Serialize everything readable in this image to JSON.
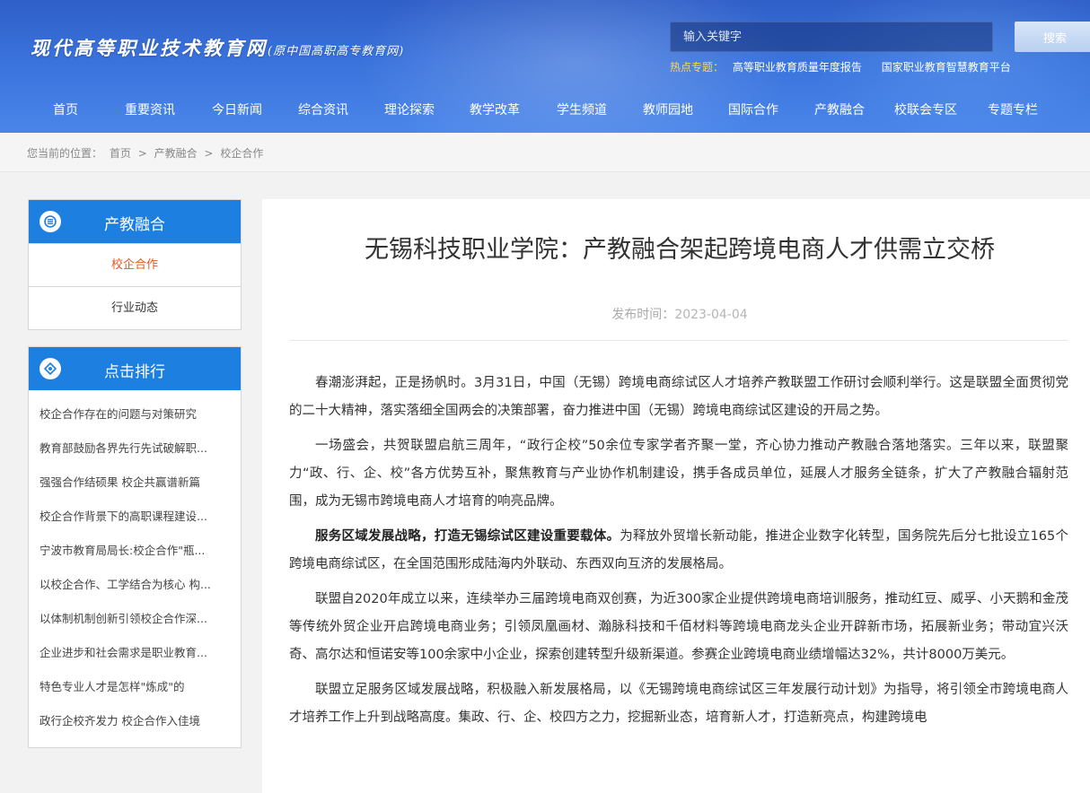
{
  "header": {
    "logo_main": "现代高等职业技术教育网",
    "logo_sub": "(原中国高职高专教育网)",
    "search_placeholder": "输入关键字",
    "search_button": "搜索",
    "hot_label": "热点专题：",
    "hot_links": [
      "高等职业教育质量年度报告",
      "国家职业教育智慧教育平台"
    ]
  },
  "nav": {
    "items": [
      "首页",
      "重要资讯",
      "今日新闻",
      "综合资讯",
      "理论探索",
      "教学改革",
      "学生频道",
      "教师园地",
      "国际合作",
      "产教融合",
      "校联会专区",
      "专题专栏"
    ]
  },
  "breadcrumb": {
    "label": "您当前的位置：",
    "items": [
      "首页",
      ">",
      "产教融合",
      ">",
      "校企合作"
    ]
  },
  "sidebar": {
    "category_title": "产教融合",
    "category_items": [
      "校企合作",
      "行业动态"
    ],
    "rank_title": "点击排行",
    "rank_items": [
      "校企合作存在的问题与对策研究",
      "教育部鼓励各界先行先试破解职...",
      "强强合作结硕果 校企共赢谱新篇",
      "校企合作背景下的高职课程建设...",
      "宁波市教育局局长:校企合作\"瓶...",
      "以校企合作、工学结合为核心 构...",
      "以体制机制创新引领校企合作深...",
      "企业进步和社会需求是职业教育...",
      "特色专业人才是怎样\"炼成\"的",
      "政行企校齐发力 校企合作入佳境"
    ]
  },
  "article": {
    "title": "无锡科技职业学院：产教融合架起跨境电商人才供需立交桥",
    "date_label": "发布时间：",
    "date": "2023-04-04",
    "p1": "春潮澎湃起，正是扬帆时。3月31日，中国（无锡）跨境电商综试区人才培养产教联盟工作研讨会顺利举行。这是联盟全面贯彻党的二十大精神，落实落细全国两会的决策部署，奋力推进中国（无锡）跨境电商综试区建设的开局之势。",
    "p2": "一场盛会，共贺联盟启航三周年，“政行企校”50余位专家学者齐聚一堂，齐心协力推动产教融合落地落实。三年以来，联盟聚力“政、行、企、校”各方优势互补，聚焦教育与产业协作机制建设，携手各成员单位，延展人才服务全链条，扩大了产教融合辐射范围，成为无锡市跨境电商人才培育的响亮品牌。",
    "p3_bold": "服务区域发展战略，打造无锡综试区建设重要载体。",
    "p3_rest": "为释放外贸增长新动能，推进企业数字化转型，国务院先后分七批设立165个跨境电商综试区，在全国范围形成陆海内外联动、东西双向互济的发展格局。",
    "p4": "联盟自2020年成立以来，连续举办三届跨境电商双创赛，为近300家企业提供跨境电商培训服务，推动红豆、威孚、小天鹅和金茂等传统外贸企业开启跨境电商业务；引领凤凰画材、瀚脉科技和千佰材料等跨境电商龙头企业开辟新市场，拓展新业务；带动宜兴沃奇、高尔达和恒诺安等100余家中小企业，探索创建转型升级新渠道。参赛企业跨境电商业绩增幅达32%，共计8000万美元。",
    "p5": "联盟立足服务区域发展战略，积极融入新发展格局，以《无锡跨境电商综试区三年发展行动计划》为指导，将引领全市跨境电商人才培养工作上升到战略高度。集政、行、企、校四方之力，挖掘新业态，培育新人才，打造新亮点，构建跨境电"
  }
}
